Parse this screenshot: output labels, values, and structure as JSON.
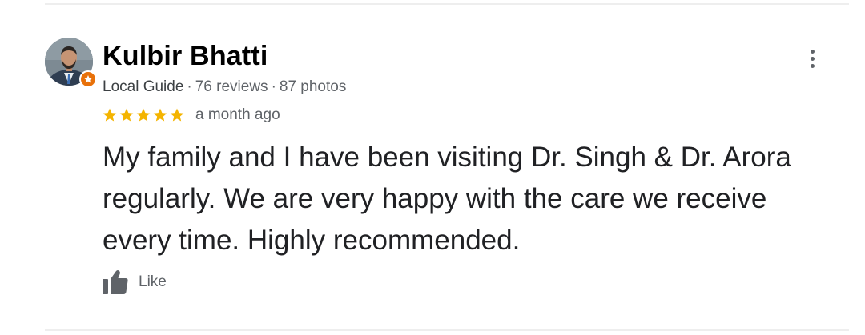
{
  "review": {
    "author": {
      "name": "Kulbir Bhatti",
      "badge": "Local Guide",
      "separator": "·",
      "reviews": "76 reviews",
      "photos": "87 photos",
      "avatar_icon": "user-avatar-photo",
      "badge_icon": "local-guide-star-icon"
    },
    "rating": {
      "stars": 5,
      "max": 5,
      "star_color": "#f4b400",
      "date": "a month ago"
    },
    "text": "My family and I have been visiting Dr. Singh & Dr. Arora regularly. We are very happy with the care we receive every time. Highly recommended.",
    "actions": {
      "like_label": "Like",
      "like_icon": "thumb-up-icon",
      "more_icon": "more-vert-icon"
    },
    "colors": {
      "name": "#000000",
      "secondary_text": "#5f6368",
      "body_text": "#202124",
      "badge_orange": "#e8710a",
      "divider": "#eeeeee"
    }
  }
}
